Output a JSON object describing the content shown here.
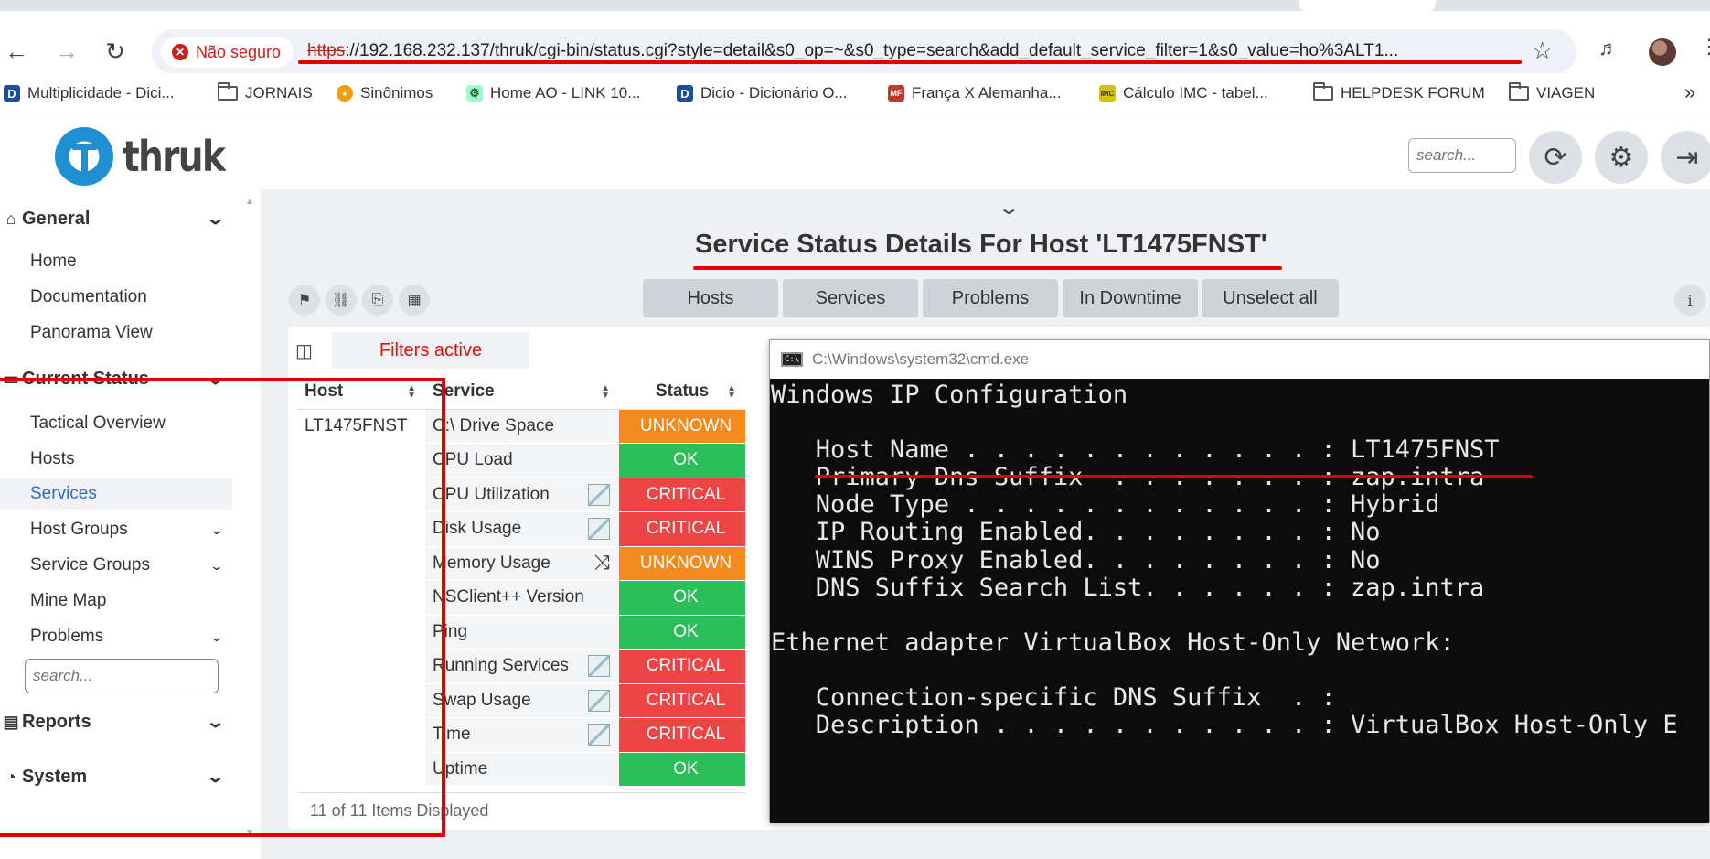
{
  "browser": {
    "security_label": "Não seguro",
    "url_scheme": "https",
    "url_rest": "://192.168.232.137/thruk/cgi-bin/status.cgi?style=detail&s0_op=~&s0_type=search&add_default_service_filter=1&s0_value=ho%3ALT1...",
    "bookmarks": [
      {
        "label": "Multiplicidade - Dici...",
        "icon": "dicio-icon"
      },
      {
        "label": "JORNAIS",
        "icon": "folder-icon"
      },
      {
        "label": "Sinônimos",
        "icon": "sinonimos-icon"
      },
      {
        "label": "Home AO - LINK 10...",
        "icon": "link-icon"
      },
      {
        "label": "Dicio - Dicionário O...",
        "icon": "dicio-icon"
      },
      {
        "label": "França X Alemanha...",
        "icon": "mf-icon"
      },
      {
        "label": "Cálculo IMC - tabel...",
        "icon": "imc-icon"
      },
      {
        "label": "HELPDESK FORUM",
        "icon": "folder-icon"
      },
      {
        "label": "VIAGEN",
        "icon": "folder-icon"
      }
    ]
  },
  "header": {
    "logo_text": "thruk",
    "search_placeholder": "search..."
  },
  "sidebar": {
    "sections": {
      "general": "General",
      "current_status": "Current Status",
      "reports": "Reports",
      "system": "System"
    },
    "items": {
      "home": "Home",
      "documentation": "Documentation",
      "panorama": "Panorama View",
      "tactical": "Tactical Overview",
      "hosts": "Hosts",
      "services": "Services",
      "host_groups": "Host Groups",
      "service_groups": "Service Groups",
      "mine_map": "Mine Map",
      "problems": "Problems"
    },
    "search_placeholder": "search..."
  },
  "main": {
    "title": "Service Status Details For Host 'LT1475FNST'",
    "filter_tabs": [
      "Hosts",
      "Services",
      "Problems",
      "In Downtime",
      "Unselect all"
    ],
    "filters_active": "Filters active",
    "table": {
      "headers": [
        "Host",
        "Service",
        "Status"
      ],
      "host": "LT1475FNST",
      "rows": [
        {
          "service": "C:\\ Drive Space",
          "status": "UNKNOWN",
          "icon": ""
        },
        {
          "service": "CPU Load",
          "status": "OK",
          "icon": ""
        },
        {
          "service": "CPU Utilization",
          "status": "CRITICAL",
          "icon": "graph"
        },
        {
          "service": "Disk Usage",
          "status": "CRITICAL",
          "icon": "graph"
        },
        {
          "service": "Memory Usage",
          "status": "UNKNOWN",
          "icon": "shuffle"
        },
        {
          "service": "NSClient++ Version",
          "status": "OK",
          "icon": ""
        },
        {
          "service": "Ping",
          "status": "OK",
          "icon": ""
        },
        {
          "service": "Running Services",
          "status": "CRITICAL",
          "icon": "graph"
        },
        {
          "service": "Swap Usage",
          "status": "CRITICAL",
          "icon": "graph"
        },
        {
          "service": "Time",
          "status": "CRITICAL",
          "icon": "graph"
        },
        {
          "service": "Uptime",
          "status": "OK",
          "icon": ""
        }
      ],
      "footer": "11 of 11 Items Displayed"
    }
  },
  "cmd": {
    "title": "C:\\Windows\\system32\\cmd.exe",
    "lines": [
      "Windows IP Configuration",
      "",
      "   Host Name . . . . . . . . . . . . : LT1475FNST",
      "   Primary Dns Suffix  . . . . . . . : zap.intra",
      "   Node Type . . . . . . . . . . . . : Hybrid",
      "   IP Routing Enabled. . . . . . . . : No",
      "   WINS Proxy Enabled. . . . . . . . : No",
      "   DNS Suffix Search List. . . . . . : zap.intra",
      "",
      "Ethernet adapter VirtualBox Host-Only Network:",
      "",
      "   Connection-specific DNS Suffix  . :",
      "   Description . . . . . . . . . . . : VirtualBox Host-Only E"
    ]
  },
  "colors": {
    "ok": "#2bbf5a",
    "critical": "#ef4444",
    "unknown": "#f28a1d",
    "annotation": "#e00000",
    "link_active": "#2a6bd1"
  }
}
